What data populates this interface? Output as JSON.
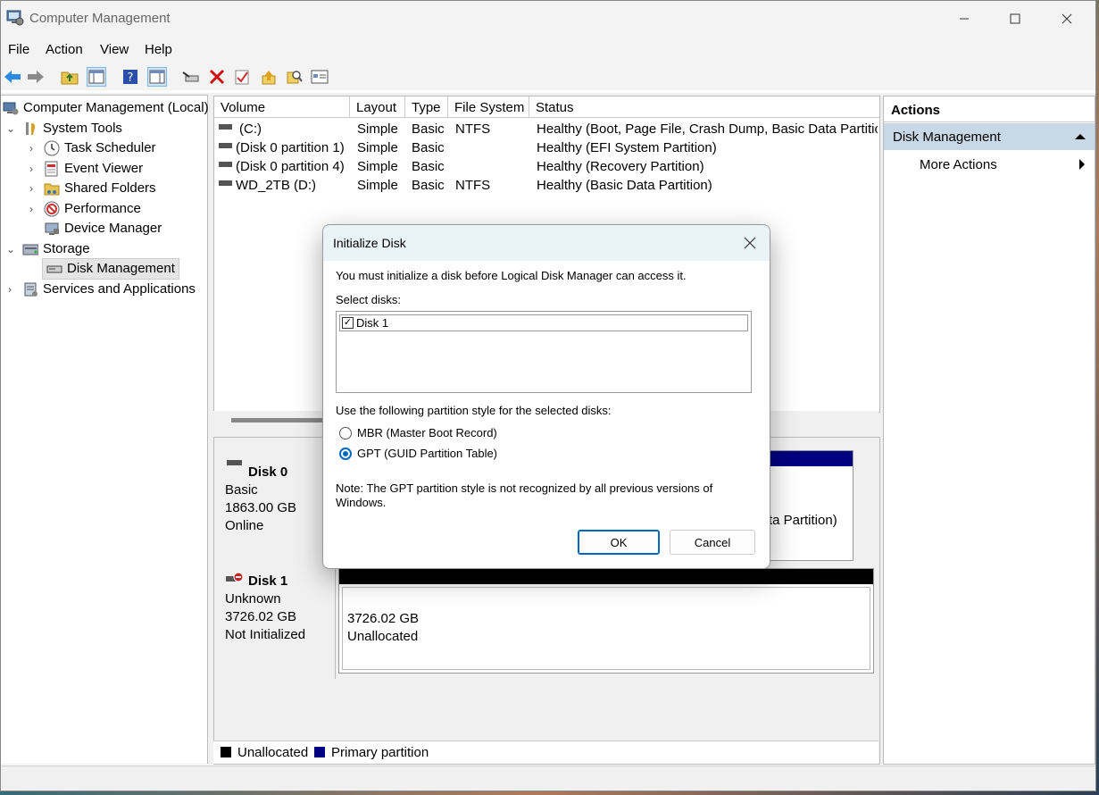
{
  "window": {
    "title": "Computer Management",
    "minimize_icon": "minimize-icon",
    "maximize_icon": "maximize-icon",
    "close_icon": "close-icon"
  },
  "menu": [
    "File",
    "Action",
    "View",
    "Help"
  ],
  "tree": {
    "root": "Computer Management (Local)",
    "system_tools": "System Tools",
    "task_scheduler": "Task Scheduler",
    "event_viewer": "Event Viewer",
    "shared_folders": "Shared Folders",
    "performance": "Performance",
    "device_manager": "Device Manager",
    "storage": "Storage",
    "disk_management": "Disk Management",
    "services": "Services and Applications"
  },
  "volumes": {
    "headers": [
      "Volume",
      "Layout",
      "Type",
      "File System",
      "Status"
    ],
    "rows": [
      {
        "volume": "(C:)",
        "layout": "Simple",
        "type": "Basic",
        "fs": "NTFS",
        "status": "Healthy (Boot, Page File, Crash Dump, Basic Data Partition"
      },
      {
        "volume": "(Disk 0 partition 1)",
        "layout": "Simple",
        "type": "Basic",
        "fs": "",
        "status": "Healthy (EFI System Partition)"
      },
      {
        "volume": "(Disk 0 partition 4)",
        "layout": "Simple",
        "type": "Basic",
        "fs": "",
        "status": "Healthy (Recovery Partition)"
      },
      {
        "volume": "WD_2TB (D:)",
        "layout": "Simple",
        "type": "Basic",
        "fs": "NTFS",
        "status": "Healthy (Basic Data Partition)"
      }
    ]
  },
  "disks": {
    "disk0": {
      "name": "Disk 0",
      "type": "Basic",
      "size": "1863.00 GB",
      "state": "Online",
      "partial_text": "ta Partition)"
    },
    "disk1": {
      "name": "Disk 1",
      "type": "Unknown",
      "size": "3726.02 GB",
      "state": "Not Initialized",
      "part_size": "3726.02 GB",
      "part_state": "Unallocated"
    }
  },
  "legend": {
    "unallocated": "Unallocated",
    "primary": "Primary partition"
  },
  "actions": {
    "header": "Actions",
    "section": "Disk Management",
    "more": "More Actions"
  },
  "dialog": {
    "title": "Initialize Disk",
    "message": "You must initialize a disk before Logical Disk Manager can access it.",
    "select_label": "Select disks:",
    "disk_item": "Disk 1",
    "style_label": "Use the following partition style for the selected disks:",
    "mbr": "MBR (Master Boot Record)",
    "gpt": "GPT (GUID Partition Table)",
    "note": "Note: The GPT partition style is not recognized by all previous versions of Windows.",
    "ok": "OK",
    "cancel": "Cancel",
    "selected_style": "GPT (GUID Partition Table)"
  },
  "colors": {
    "primary_partition": "#000080",
    "unallocated": "#000000",
    "accent": "#0067c0"
  }
}
